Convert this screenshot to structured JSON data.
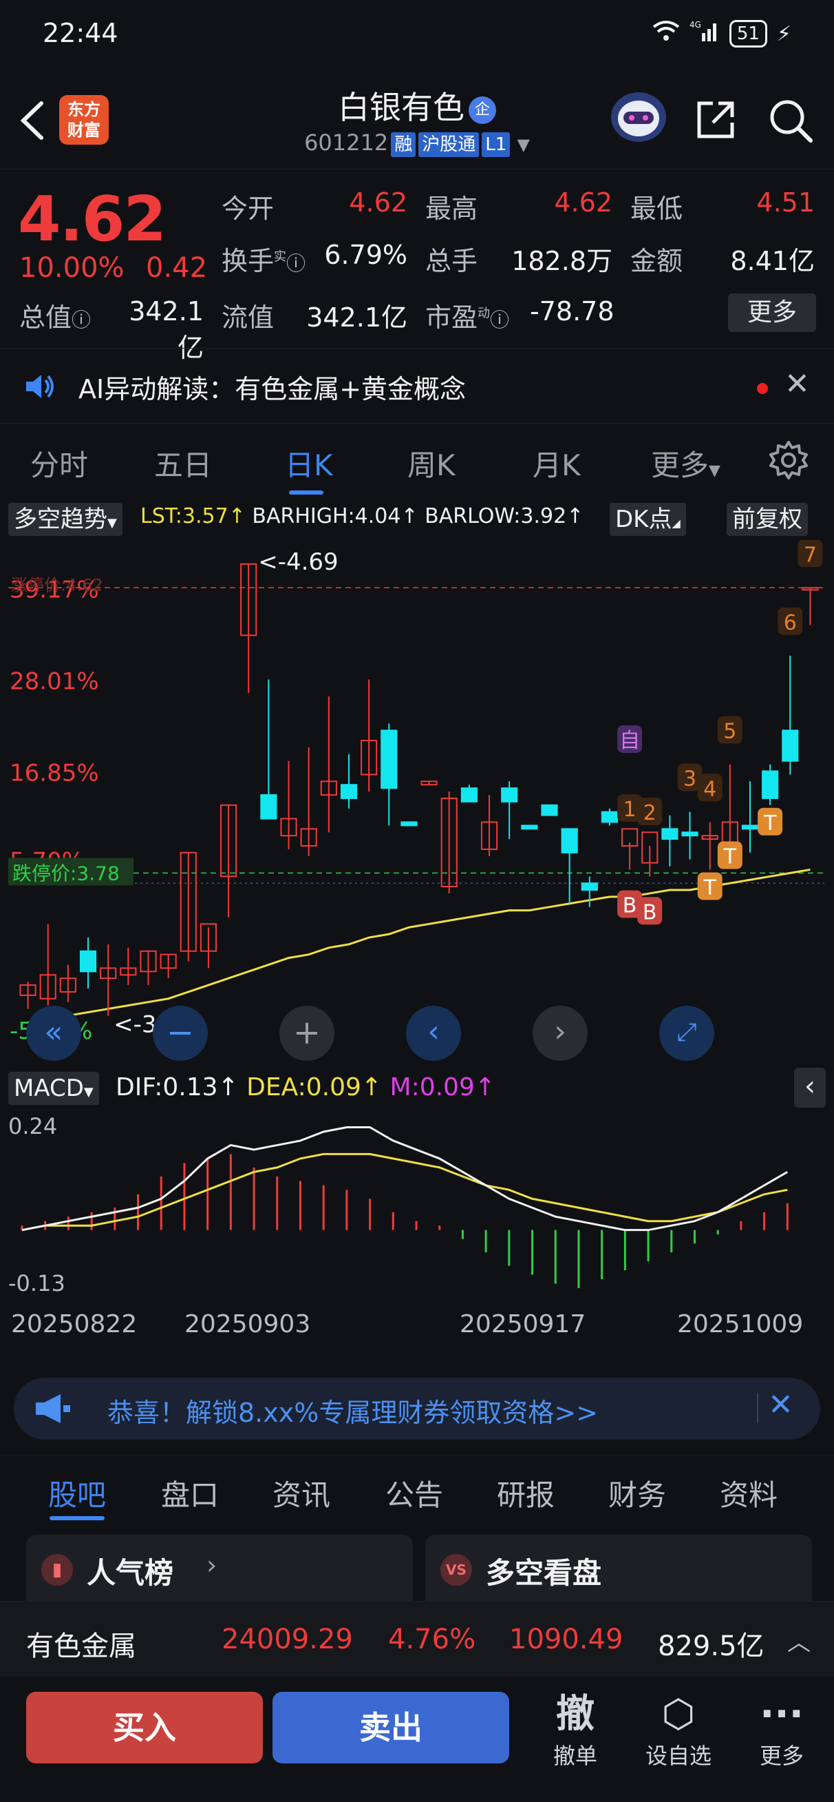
{
  "status": {
    "time": "22:44",
    "network": "4G",
    "battery": "51"
  },
  "header": {
    "logo_line1": "东方",
    "logo_line2": "财富",
    "stock_name": "白银有色",
    "name_badge": "企",
    "stock_code": "601212",
    "tags": [
      "融",
      "沪股通",
      "L1"
    ]
  },
  "quote": {
    "price": "4.62",
    "pct_change": "10.00%",
    "abs_change": "0.42",
    "fields": [
      {
        "label": "今开",
        "value": "4.62",
        "color": "#ef3b3b"
      },
      {
        "label": "最高",
        "value": "4.62",
        "color": "#ef3b3b"
      },
      {
        "label": "最低",
        "value": "4.51",
        "color": "#ef3b3b"
      },
      {
        "label": "换手",
        "value": "6.79%",
        "color": "#f2f2f2"
      },
      {
        "label": "总手",
        "value": "182.8万",
        "color": "#f2f2f2"
      },
      {
        "label": "金额",
        "value": "8.41亿",
        "color": "#f2f2f2"
      },
      {
        "label": "总值",
        "value": "342.1亿",
        "color": "#f2f2f2"
      },
      {
        "label": "流值",
        "value": "342.1亿",
        "color": "#f2f2f2"
      },
      {
        "label": "市盈",
        "value": "-78.78",
        "color": "#f2f2f2"
      }
    ],
    "turnover_sup": "实",
    "pe_sup": "动",
    "more_label": "更多"
  },
  "ai_bar": {
    "text": "AI异动解读：有色金属+黄金概念"
  },
  "period_tabs": [
    "分时",
    "五日",
    "日K",
    "周K",
    "月K",
    "更多"
  ],
  "chart_toolbar": {
    "indicator": "多空趋势",
    "lst": "LST:3.57",
    "barhigh": "BARHIGH:4.04",
    "barlow": "BARLOW:3.92",
    "dk_label": "DK点",
    "adjust_label": "前复权"
  },
  "chart_data": [
    {
      "type": "candlestick",
      "y_axis_labels": [
        "39.17%",
        "28.01%",
        "16.85%",
        "5.70%",
        "-5.46%"
      ],
      "limit_up_label": "涨停价:4.62",
      "limit_down_label": "跌停价:3.78",
      "max_annotation": "<-4.69",
      "min_annotation": "<-3.34",
      "ylim": [
        3.3,
        4.72
      ],
      "candles": [
        {
          "o": 3.42,
          "h": 3.46,
          "l": 3.38,
          "c": 3.45
        },
        {
          "o": 3.41,
          "h": 3.63,
          "l": 3.39,
          "c": 3.48
        },
        {
          "o": 3.43,
          "h": 3.51,
          "l": 3.4,
          "c": 3.47
        },
        {
          "o": 3.55,
          "h": 3.59,
          "l": 3.44,
          "c": 3.49
        },
        {
          "o": 3.47,
          "h": 3.57,
          "l": 3.36,
          "c": 3.5
        },
        {
          "o": 3.48,
          "h": 3.56,
          "l": 3.45,
          "c": 3.5
        },
        {
          "o": 3.49,
          "h": 3.55,
          "l": 3.45,
          "c": 3.55
        },
        {
          "o": 3.5,
          "h": 3.54,
          "l": 3.47,
          "c": 3.54
        },
        {
          "o": 3.55,
          "h": 3.84,
          "l": 3.52,
          "c": 3.84
        },
        {
          "o": 3.55,
          "h": 3.62,
          "l": 3.5,
          "c": 3.63
        },
        {
          "o": 3.77,
          "h": 3.98,
          "l": 3.65,
          "c": 3.98
        },
        {
          "o": 4.48,
          "h": 4.69,
          "l": 4.31,
          "c": 4.69
        },
        {
          "o": 4.01,
          "h": 4.35,
          "l": 3.99,
          "c": 3.94
        },
        {
          "o": 3.89,
          "h": 4.11,
          "l": 3.85,
          "c": 3.94
        },
        {
          "o": 3.86,
          "h": 4.15,
          "l": 3.83,
          "c": 3.91
        },
        {
          "o": 4.01,
          "h": 4.3,
          "l": 3.9,
          "c": 4.05
        },
        {
          "o": 4.04,
          "h": 4.13,
          "l": 3.97,
          "c": 4.0
        },
        {
          "o": 4.07,
          "h": 4.35,
          "l": 4.02,
          "c": 4.17
        },
        {
          "o": 4.2,
          "h": 4.22,
          "l": 3.92,
          "c": 4.03
        },
        {
          "o": 3.93,
          "h": 3.93,
          "l": 3.92,
          "c": 3.92
        },
        {
          "o": 4.04,
          "h": 4.05,
          "l": 4.04,
          "c": 4.05
        },
        {
          "o": 3.74,
          "h": 4.02,
          "l": 3.72,
          "c": 4.0
        },
        {
          "o": 4.03,
          "h": 4.04,
          "l": 4.0,
          "c": 3.99
        },
        {
          "o": 3.85,
          "h": 4.01,
          "l": 3.83,
          "c": 3.93
        },
        {
          "o": 4.03,
          "h": 4.05,
          "l": 3.88,
          "c": 3.99
        },
        {
          "o": 3.92,
          "h": 3.92,
          "l": 3.91,
          "c": 3.91
        },
        {
          "o": 3.98,
          "h": 3.98,
          "l": 3.95,
          "c": 3.95
        },
        {
          "o": 3.91,
          "h": 3.88,
          "l": 3.69,
          "c": 3.84
        },
        {
          "o": 3.75,
          "h": 3.77,
          "l": 3.68,
          "c": 3.73
        },
        {
          "o": 3.96,
          "h": 3.97,
          "l": 3.92,
          "c": 3.93
        },
        {
          "o": 3.86,
          "h": 3.87,
          "l": 3.79,
          "c": 3.91
        },
        {
          "o": 3.81,
          "h": 3.86,
          "l": 3.77,
          "c": 3.9
        },
        {
          "o": 3.91,
          "h": 3.95,
          "l": 3.8,
          "c": 3.88
        },
        {
          "o": 3.9,
          "h": 3.96,
          "l": 3.82,
          "c": 3.89
        },
        {
          "o": 3.88,
          "h": 3.93,
          "l": 3.79,
          "c": 3.89
        },
        {
          "o": 3.84,
          "h": 4.1,
          "l": 3.8,
          "c": 3.93
        },
        {
          "o": 3.92,
          "h": 4.05,
          "l": 3.84,
          "c": 3.91
        },
        {
          "o": 4.08,
          "h": 4.1,
          "l": 3.98,
          "c": 4.0
        },
        {
          "o": 4.2,
          "h": 4.42,
          "l": 4.07,
          "c": 4.11
        },
        {
          "o": 4.62,
          "h": 4.62,
          "l": 4.51,
          "c": 4.62
        }
      ],
      "ma_line": [
        3.34,
        3.35,
        3.36,
        3.37,
        3.38,
        3.39,
        3.4,
        3.41,
        3.43,
        3.45,
        3.47,
        3.49,
        3.51,
        3.53,
        3.54,
        3.56,
        3.57,
        3.59,
        3.6,
        3.62,
        3.63,
        3.64,
        3.65,
        3.66,
        3.67,
        3.67,
        3.68,
        3.69,
        3.7,
        3.71,
        3.71,
        3.72,
        3.73,
        3.73,
        3.74,
        3.75,
        3.76,
        3.77,
        3.78,
        3.79
      ],
      "signals": [
        {
          "label": "自",
          "index": 30
        },
        {
          "label": "1",
          "index": 30
        },
        {
          "label": "2",
          "index": 31
        },
        {
          "label": "3",
          "index": 33
        },
        {
          "label": "4",
          "index": 34
        },
        {
          "label": "5",
          "index": 35
        },
        {
          "label": "6",
          "index": 38
        },
        {
          "label": "7",
          "index": 39
        },
        {
          "label": "B",
          "index": 30
        },
        {
          "label": "B",
          "index": 31
        },
        {
          "label": "T",
          "index": 34
        },
        {
          "label": "T",
          "index": 35
        },
        {
          "label": "T",
          "index": 37
        }
      ]
    },
    {
      "type": "bar",
      "indicator": "MACD",
      "dif": "DIF:0.13",
      "dea": "DEA:0.09",
      "m": "M:0.09",
      "y_axis_labels": [
        "0.24",
        "-0.13"
      ],
      "ylim": [
        -0.13,
        0.24
      ],
      "dif_values": [
        0.0,
        0.01,
        0.02,
        0.03,
        0.04,
        0.05,
        0.07,
        0.11,
        0.16,
        0.19,
        0.18,
        0.19,
        0.2,
        0.22,
        0.23,
        0.23,
        0.2,
        0.18,
        0.16,
        0.13,
        0.1,
        0.07,
        0.05,
        0.03,
        0.02,
        0.01,
        0.0,
        0.0,
        0.01,
        0.02,
        0.04,
        0.07,
        0.1,
        0.13
      ],
      "dea_values": [
        0.0,
        0.01,
        0.01,
        0.01,
        0.02,
        0.03,
        0.05,
        0.07,
        0.09,
        0.11,
        0.13,
        0.14,
        0.16,
        0.17,
        0.17,
        0.17,
        0.16,
        0.15,
        0.14,
        0.12,
        0.1,
        0.09,
        0.07,
        0.06,
        0.05,
        0.04,
        0.03,
        0.02,
        0.02,
        0.03,
        0.04,
        0.06,
        0.08,
        0.09
      ],
      "hist_values": [
        0.01,
        0.02,
        0.03,
        0.04,
        0.05,
        0.08,
        0.12,
        0.15,
        0.16,
        0.17,
        0.14,
        0.12,
        0.11,
        0.1,
        0.09,
        0.07,
        0.04,
        0.02,
        0.01,
        -0.02,
        -0.05,
        -0.08,
        -0.1,
        -0.12,
        -0.13,
        -0.11,
        -0.09,
        -0.07,
        -0.05,
        -0.03,
        -0.01,
        0.02,
        0.04,
        0.06
      ]
    }
  ],
  "date_axis": [
    "20250822",
    "20250903",
    "20250917",
    "20251009"
  ],
  "banner": {
    "text": "恭喜！解锁8.xx%专属理财券领取资格>>"
  },
  "lower_tabs": [
    "股吧",
    "盘口",
    "资讯",
    "公告",
    "研报",
    "财务",
    "资料"
  ],
  "cards": [
    {
      "label": "人气榜",
      "icon": "bar-chart-icon"
    },
    {
      "label": "多空看盘",
      "icon": "vs-icon",
      "badge": "VS"
    }
  ],
  "sector": {
    "name": "有色金属",
    "index": "24009.29",
    "pct": "4.76%",
    "points": "1090.49",
    "amount": "829.5亿"
  },
  "bottom": {
    "buy": "买入",
    "sell": "卖出",
    "actions": [
      {
        "icon": "撤",
        "label": "撤单"
      },
      {
        "icon": "⬡",
        "label": "设自选"
      },
      {
        "icon": "···",
        "label": "更多"
      }
    ]
  },
  "colors": {
    "up": "#ef3b3b",
    "down": "#14e6f0",
    "flat_green": "#2fcf48",
    "ma": "#f0e040",
    "accent": "#3e86f5"
  }
}
